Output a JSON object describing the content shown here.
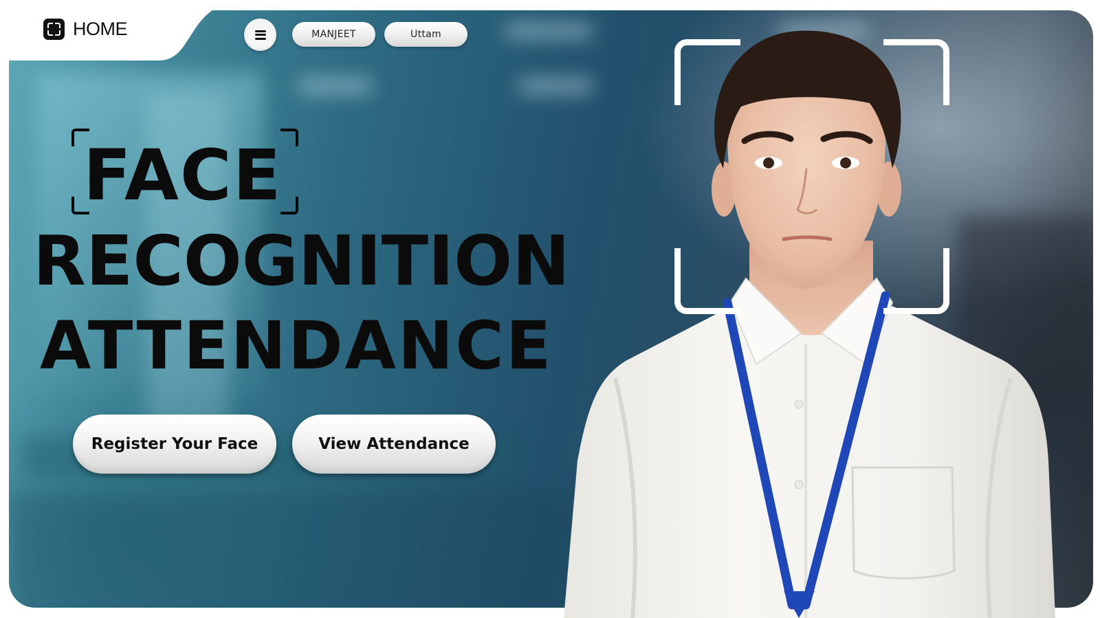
{
  "nav": {
    "home_label": "HOME",
    "home_icon": "scan-frame-icon",
    "menu_icon": "hamburger-menu-icon",
    "user_pills": [
      {
        "label": "MANJEET"
      },
      {
        "label": "Uttam"
      }
    ]
  },
  "hero": {
    "title_line_1": "FACE",
    "title_line_2": "RECOGNITION",
    "title_line_3": "ATTENDANCE",
    "buttons": {
      "register_label": "Register Your Face",
      "view_attendance_label": "View Attendance"
    },
    "image_subject": "young man in white shirt with blue lanyard",
    "colors": {
      "title": "#0b0b0b",
      "lanyard": "#1f47b8",
      "scan_frame": "#ffffff",
      "background_teal": "#3f8598",
      "background_navy": "#22506c"
    }
  }
}
